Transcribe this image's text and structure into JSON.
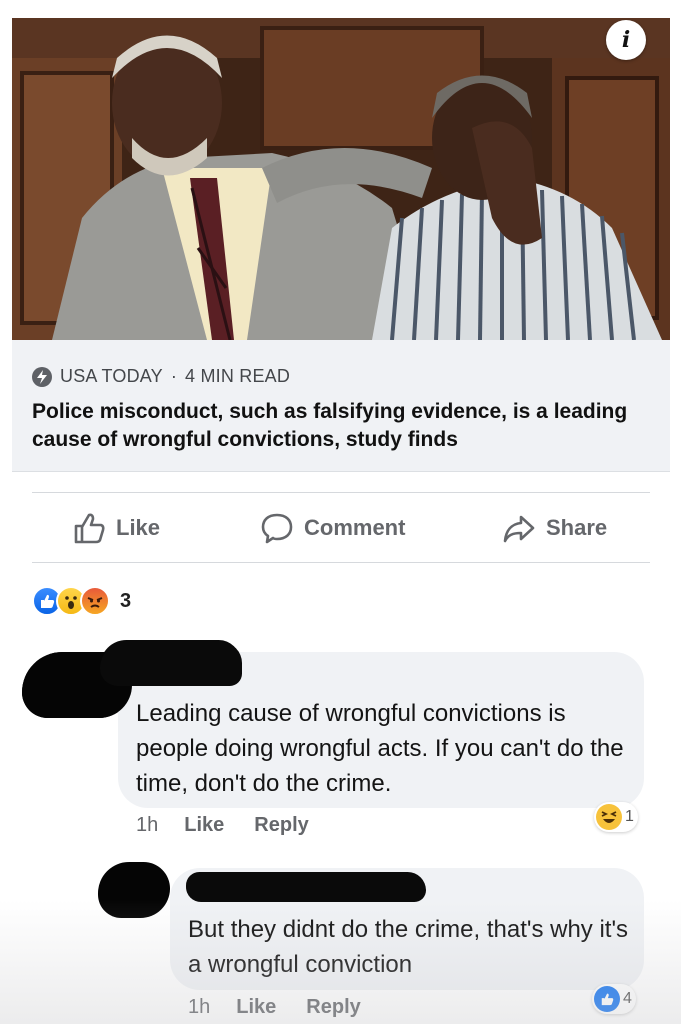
{
  "post": {
    "link": {
      "info_icon": "info-icon",
      "source": "USA TODAY",
      "read_time": "4 MIN READ",
      "headline": "Police misconduct, such as falsifying evidence, is a leading cause of wrongful convictions, study finds"
    },
    "actions": {
      "like": "Like",
      "comment": "Comment",
      "share": "Share"
    },
    "reactions": {
      "types": [
        "like",
        "wow",
        "angry"
      ],
      "count": "3"
    }
  },
  "comments": [
    {
      "text": "Leading cause of wrongful convictions is people doing wrongful acts. If you can't do the time, don't do the crime.",
      "time": "1h",
      "like_label": "Like",
      "reply_label": "Reply",
      "reaction": "haha",
      "reaction_count": "1"
    },
    {
      "text": "But they didnt do the crime, that's why it's a wrongful conviction",
      "time": "1h",
      "like_label": "Like",
      "reply_label": "Reply",
      "reaction": "like",
      "reaction_count": "4"
    }
  ],
  "colors": {
    "facebook_blue": "#1877f2",
    "muted_text": "#65676b",
    "bubble_bg": "#f0f2f5",
    "link_meta_bg": "#f0f2f5"
  }
}
